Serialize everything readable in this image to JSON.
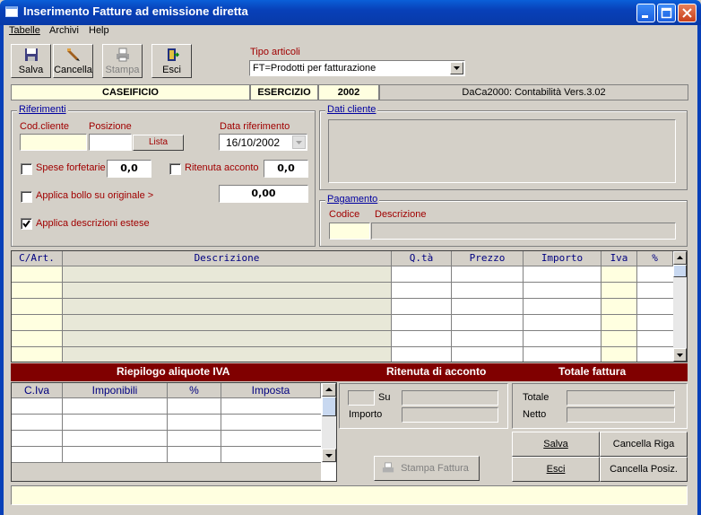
{
  "window": {
    "title": "Inserimento Fatture ad emissione diretta"
  },
  "menu": [
    "Tabelle",
    "Archivi",
    "Help"
  ],
  "toolbar": {
    "salva": "Salva",
    "cancella": "Cancella",
    "stampa": "Stampa",
    "esci": "Esci"
  },
  "tipo_articoli": {
    "label": "Tipo articoli",
    "value": "FT=Prodotti per fatturazione"
  },
  "infobar": {
    "company": "CASEIFICIO",
    "esercizio_label": "ESERCIZIO",
    "esercizio": "2002",
    "app": "DaCa2000: Contabilità Vers.3.02"
  },
  "riferimenti": {
    "title": "Riferimenti",
    "cod_cliente_label": "Cod.cliente",
    "cod_cliente": "",
    "posizione_label": "Posizione",
    "posizione": "",
    "lista_button": "Lista",
    "data_label": "Data riferimento",
    "data": "16/10/2002",
    "spese_label": "Spese forfetarie",
    "spese": "0,0",
    "ritenuta_label": "Ritenuta acconto",
    "ritenuta": "0,0",
    "bollo_label": "Applica bollo su originale",
    "bollo_arrow": ">",
    "bollo": "0,00",
    "descr_estese_label": "Applica descrizioni estese"
  },
  "dati_cliente": {
    "title": "Dati cliente"
  },
  "pagamento": {
    "title": "Pagamento",
    "codice_label": "Codice",
    "descrizione_label": "Descrizione"
  },
  "grid": {
    "headers": [
      "C/Art.",
      "Descrizione",
      "Q.tà",
      "Prezzo",
      "Importo",
      "Iva",
      "%"
    ]
  },
  "riepilogo": {
    "title": "Riepilogo aliquote IVA",
    "headers": [
      "C.Iva",
      "Imponibili",
      "%",
      "Imposta"
    ]
  },
  "ritenuta_box": {
    "title": "Ritenuta di acconto",
    "su_label": "Su",
    "importo_label": "Importo"
  },
  "totale_box": {
    "title": "Totale fattura",
    "totale_label": "Totale",
    "netto_label": "Netto"
  },
  "bottom_buttons": {
    "stampa_fattura": "Stampa Fattura",
    "salva": "Salva",
    "cancella_riga": "Cancella Riga",
    "esci": "Esci",
    "cancella_posiz": "Cancella Posiz."
  },
  "colors": {
    "title_blue": "#0840b8",
    "info_yellow": "#ffffe0",
    "bar_red": "#800000"
  }
}
